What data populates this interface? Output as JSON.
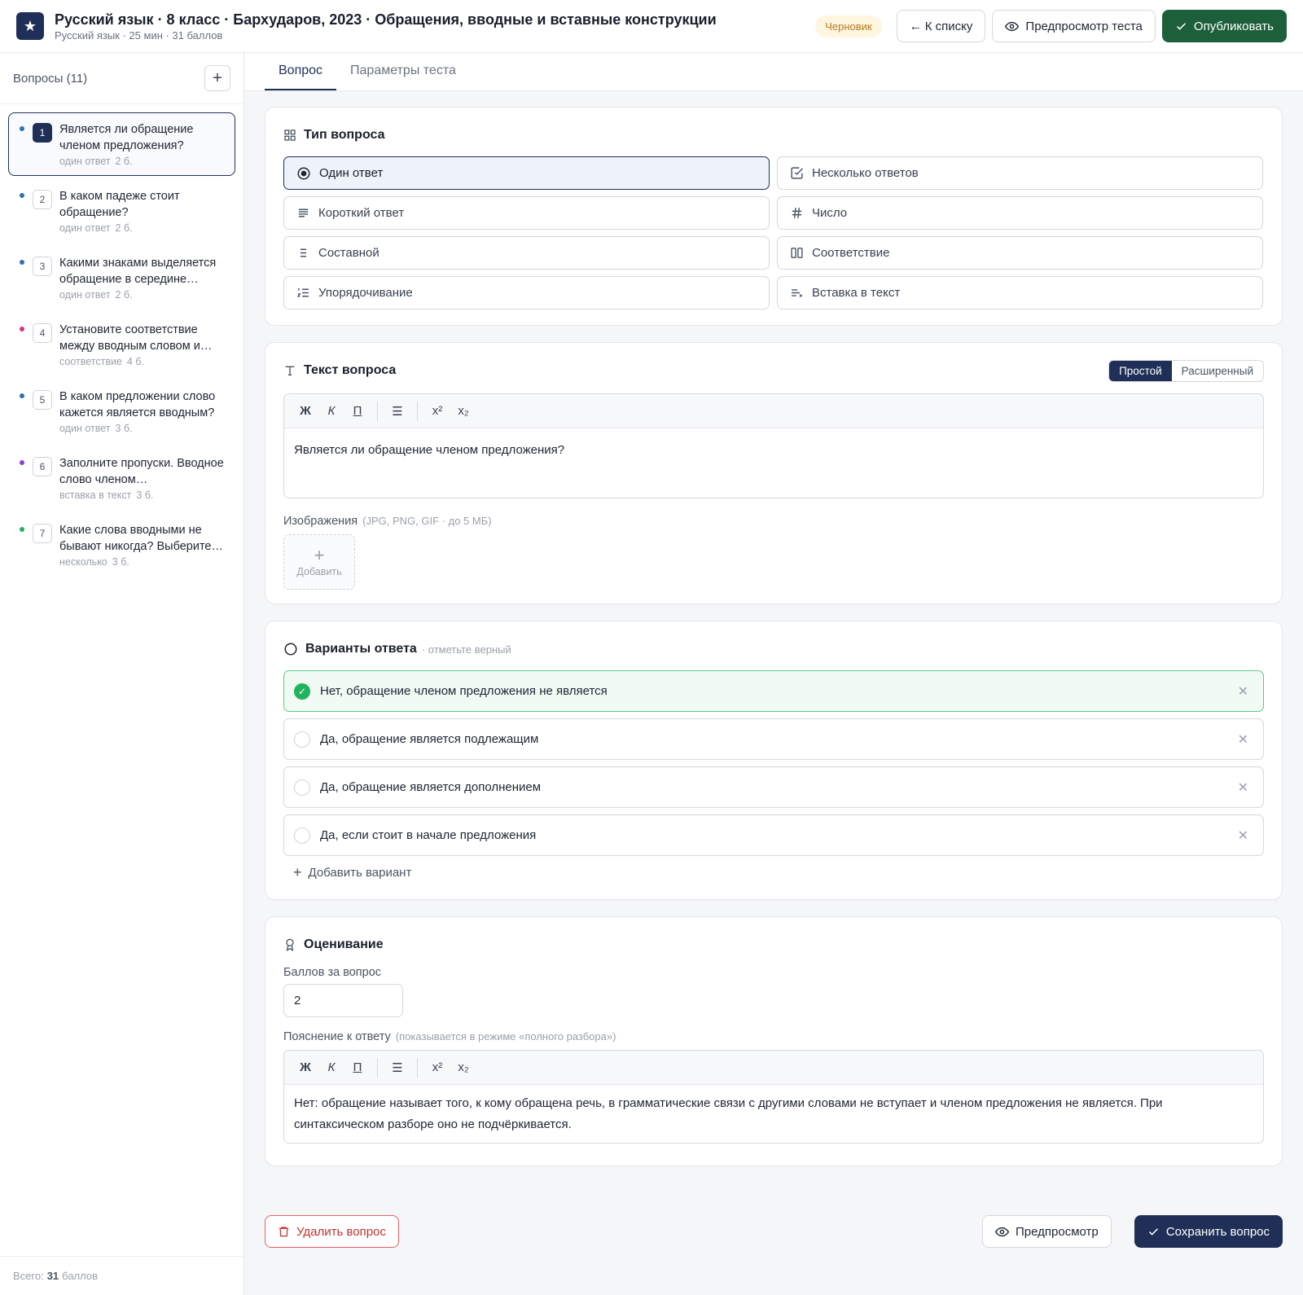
{
  "header": {
    "title": "Русский язык · 8 класс · Бархударов, 2023 · Обращения, вводные и вставные конструкции",
    "subtitle": "Русский язык · 25 мин · 31 баллов",
    "status": "Черновик",
    "back_label": "← К списку",
    "preview_label": "Предпросмотр теста",
    "publish_label": "Опубликовать"
  },
  "sidebar": {
    "heading": "Вопросы (11)",
    "items": [
      {
        "num": "1",
        "text": "Является ли обращение членом предложения?",
        "type": "один ответ",
        "points": "2 б.",
        "color": "#2f6fb3"
      },
      {
        "num": "2",
        "text": "В каком падеже стоит обращение?",
        "type": "один ответ",
        "points": "2 б.",
        "color": "#2f6fb3"
      },
      {
        "num": "3",
        "text": "Какими знаками выделяется обращение в середине…",
        "type": "один ответ",
        "points": "2 б.",
        "color": "#2f6fb3"
      },
      {
        "num": "4",
        "text": "Установите соответствие между вводным словом и…",
        "type": "соответствие",
        "points": "4 б.",
        "color": "#d63384"
      },
      {
        "num": "5",
        "text": "В каком предложении слово кажется является вводным?",
        "type": "один ответ",
        "points": "3 б.",
        "color": "#2f6fb3"
      },
      {
        "num": "6",
        "text": "Заполните пропуски. Вводное слово членом…",
        "type": "вставка в текст",
        "points": "3 б.",
        "color": "#8b3fd6"
      },
      {
        "num": "7",
        "text": "Какие слова вводными не бывают никогда? Выберите…",
        "type": "несколько",
        "points": "3 б.",
        "color": "#22b35e"
      }
    ],
    "footer_prefix": "Всего:",
    "footer_total": "31",
    "footer_suffix": "баллов"
  },
  "tabs": [
    "Вопрос",
    "Параметры теста"
  ],
  "type_card": {
    "title": "Тип вопроса",
    "options": [
      "Один ответ",
      "Несколько ответов",
      "Короткий ответ",
      "Число",
      "Составной",
      "Соответствие",
      "Упорядочивание",
      "Вставка в текст"
    ]
  },
  "text_card": {
    "title": "Текст вопроса",
    "mode_simple": "Простой",
    "mode_advanced": "Расширенный",
    "toolbar": {
      "bold": "Ж",
      "italic": "К",
      "underline": "П",
      "list": "☰",
      "sup": "x²",
      "sub": "x₂"
    },
    "body": "Является ли обращение членом предложения?",
    "images_label": "Изображения",
    "images_hint": "(JPG, PNG, GIF · до 5 МБ)",
    "add_label": "Добавить"
  },
  "answers_card": {
    "title": "Варианты ответа",
    "hint": "· отметьте верный",
    "options": [
      {
        "text": "Нет, обращение членом предложения не является",
        "correct": true
      },
      {
        "text": "Да, обращение является подлежащим",
        "correct": false
      },
      {
        "text": "Да, обращение является дополнением",
        "correct": false
      },
      {
        "text": "Да, если стоит в начале предложения",
        "correct": false
      }
    ],
    "add_label": "Добавить вариант"
  },
  "grading_card": {
    "title": "Оценивание",
    "points_label": "Баллов за вопрос",
    "points_value": "2",
    "explain_label": "Пояснение к ответу",
    "explain_hint": "(показывается в режиме «полного разбора»)",
    "explain_body": "Нет: обращение называет того, к кому обращена речь, в грамматические связи с другими словами не вступает и членом предложения не является. При синтаксическом разборе оно не подчёркивается."
  },
  "footer": {
    "delete_label": "Удалить вопрос",
    "preview_label": "Предпросмотр",
    "save_label": "Сохранить вопрос"
  },
  "colors": {
    "accent": "#1f2f57",
    "publish": "#1d5f3b",
    "correct": "#22b35e",
    "danger": "#c53030"
  }
}
